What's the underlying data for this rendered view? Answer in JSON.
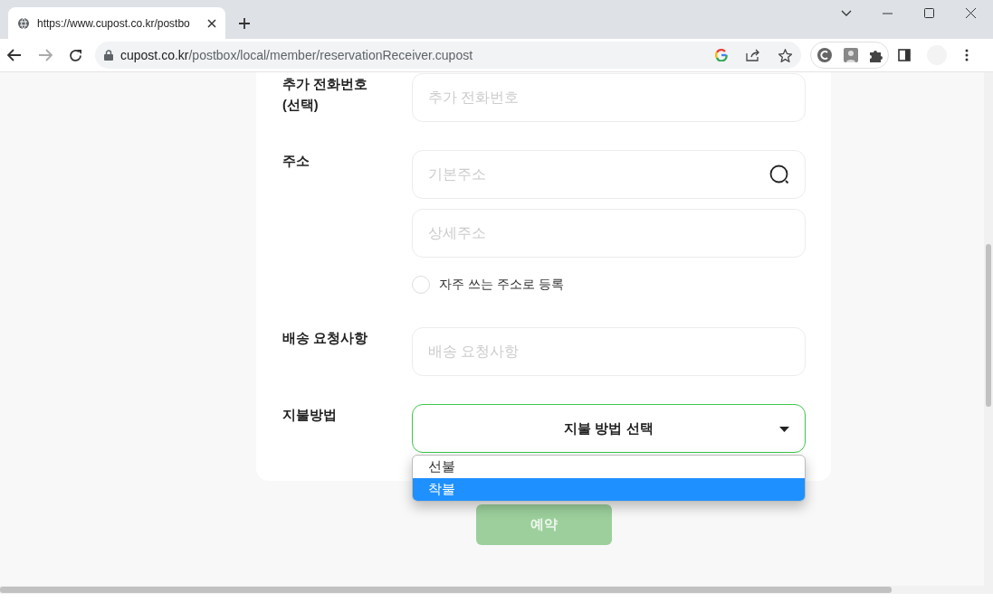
{
  "browser": {
    "tab_title": "https://www.cupost.co.kr/postbo",
    "url_host": "cupost.co.kr",
    "url_path": "/postbox/local/member/reservationReceiver.cupost"
  },
  "form": {
    "rows": [
      {
        "kind": "input",
        "label": "추가 전화번호\n(선택)",
        "fields": [
          {
            "placeholder": "추가 전화번호"
          }
        ]
      },
      {
        "kind": "address",
        "label": "주소",
        "fields": [
          {
            "placeholder": "기본주소",
            "search": true
          },
          {
            "placeholder": "상세주소"
          }
        ],
        "checkbox": {
          "label": "자주 쓰는 주소로 등록",
          "checked": false
        }
      },
      {
        "kind": "input",
        "label": "배송 요청사항",
        "fields": [
          {
            "placeholder": "배송 요청사항"
          }
        ]
      },
      {
        "kind": "select",
        "label": "지불방법",
        "value": "지불 방법 선택",
        "focused": true,
        "expanded": true,
        "options": [
          {
            "label": "선불",
            "selected": false
          },
          {
            "label": "착불",
            "selected": true
          }
        ]
      }
    ]
  },
  "submit": {
    "label": "예약",
    "disabled": true
  }
}
